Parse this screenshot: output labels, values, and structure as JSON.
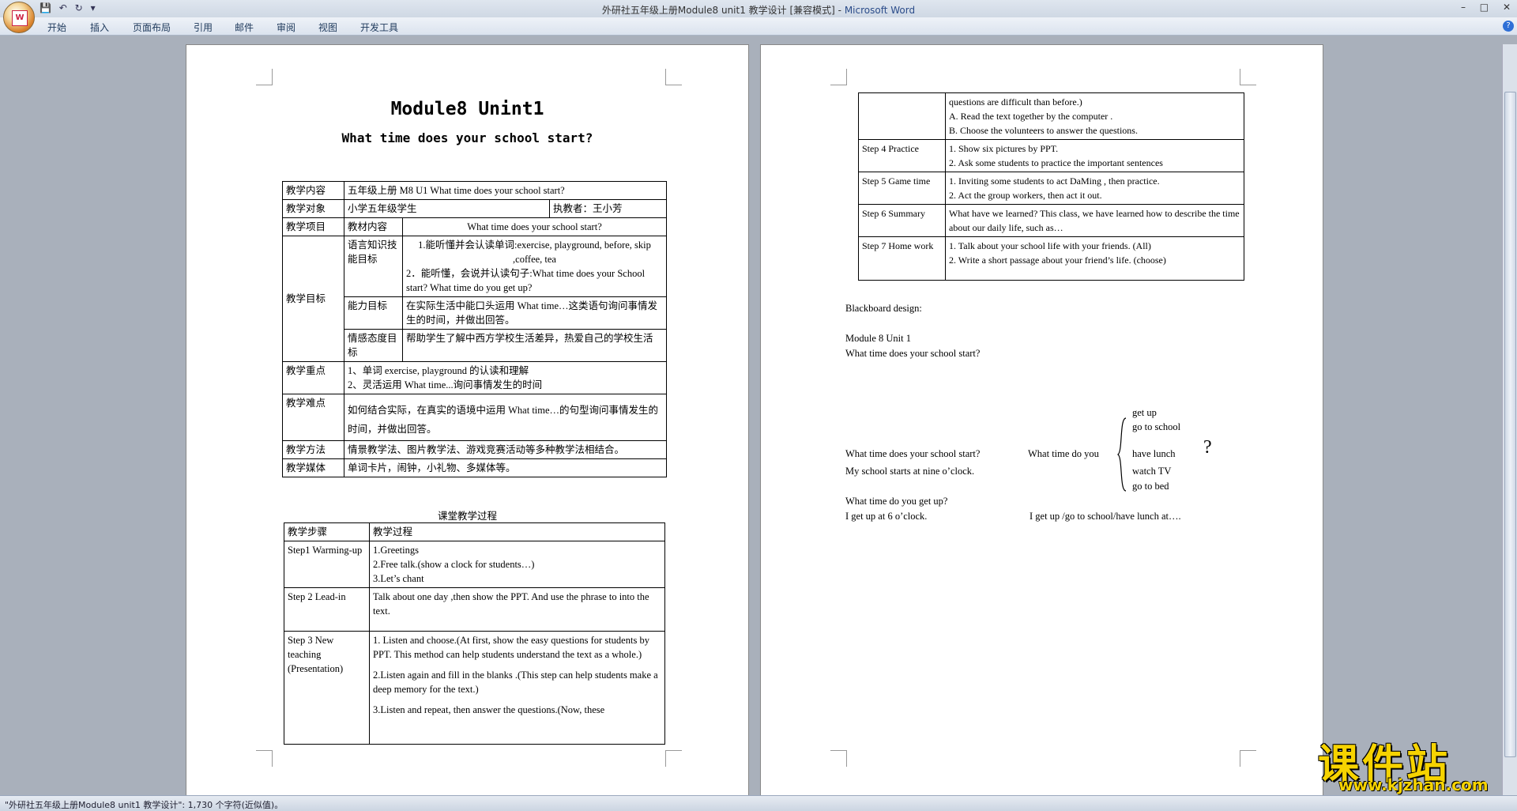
{
  "window": {
    "title": "外研社五年级上册Module8 unit1 教学设计 [兼容模式] - ",
    "app_name": "Microsoft Word",
    "office_logo": "W"
  },
  "menu": [
    "开始",
    "插入",
    "页面布局",
    "引用",
    "邮件",
    "审阅",
    "视图",
    "开发工具"
  ],
  "page1": {
    "title": "Module8 Unint1",
    "subtitle": "What time does your school start?",
    "info": {
      "content_label": "教学内容",
      "content_value": "五年级上册 M8 U1 What time does your school start?",
      "target_label": "教学对象",
      "target_value": "小学五年级学生",
      "teacher": "执教者：王小芳",
      "project_label": "教学项目",
      "material_label": "教材内容",
      "material_value": "What time does your school start?",
      "goal_label": "教学目标",
      "lang_label": "语言知识技能目标",
      "lang_1": "1.能听懂并会认读单词:exercise, playground, before, skip ,coffee, tea",
      "lang_2": "2．能听懂，会说并认读句子:What time does your School start? What time do you get up?",
      "ability_label": "能力目标",
      "ability_value": "在实际生活中能口头运用 What time…这类语句询问事情发生的时间，并做出回答。",
      "emotion_label": "情感态度目标",
      "emotion_value": "帮助学生了解中西方学校生活差异，热爱自己的学校生活",
      "key_label": "教学重点",
      "key_1": "1、单词 exercise, playground 的认读和理解",
      "key_2": "2、灵活运用 What time...询问事情发生的时间",
      "difficult_label": "教学难点",
      "difficult_value": "如何结合实际，在真实的语境中运用 What time…的句型询问事情发生的时间，并做出回答。",
      "method_label": "教学方法",
      "method_value": "情景教学法、图片教学法、游戏竞赛活动等多种教学法相结合。",
      "media_label": "教学媒体",
      "media_value": "单词卡片，闹钟，小礼物、多媒体等。"
    },
    "process_title": "课堂教学过程",
    "process_head": [
      "教学步骤",
      "教学过程"
    ],
    "steps": [
      {
        "step": "Step1 Warming-up",
        "lines": [
          "1.Greetings",
          "2.Free talk.(show a clock for students…)",
          "3.Let’s chant"
        ]
      },
      {
        "step": "Step 2 Lead-in",
        "lines": [
          "Talk about one day ,then show the PPT. And use the phrase to into the text."
        ]
      },
      {
        "step": "Step 3 New teaching (Presentation)",
        "lines": [
          "1. Listen and choose.(At first, show the easy questions for students by PPT. This method can help students understand the text as a whole.)",
          "2.Listen again and fill in the blanks .(This step can help students make a deep memory for the text.)",
          "3.Listen and repeat, then answer the questions.(Now, these"
        ]
      }
    ]
  },
  "page2": {
    "cont_lines": [
      "questions are difficult than before.)",
      "A. Read the text together by the computer .",
      "B. Choose the volunteers to answer the questions."
    ],
    "steps": [
      {
        "step": "Step 4 Practice",
        "lines": [
          "1. Show six pictures by PPT.",
          "2. Ask some students to practice the important sentences"
        ]
      },
      {
        "step": "Step 5 Game time",
        "lines": [
          "1. Inviting some students to act DaMing , then practice.",
          "2. Act the group workers, then act it out."
        ]
      },
      {
        "step": "Step 6 Summary",
        "lines": [
          "What have we learned? This class, we have learned how to describe the time about our daily life, such as…"
        ]
      },
      {
        "step": "Step 7 Home work",
        "lines": [
          "1. Talk about your school life with your friends. (All)",
          "2. Write a short passage about your friend’s life. (choose)"
        ]
      }
    ],
    "blackboard": {
      "heading": "Blackboard design:",
      "unit": "Module 8 Unit 1",
      "question": "What time does your school start?",
      "q1": "What time does your school start?",
      "a1": "My school starts at nine o’clock.",
      "prompt": "What time do you",
      "options": [
        "get up",
        "go to school",
        "have lunch",
        "watch TV",
        "go to bed"
      ],
      "qmark": "?",
      "q2": "What time do you get up?",
      "a2": "I get up at 6 o’clock.",
      "a3": "I get up /go to school/have lunch at…."
    }
  },
  "status": "\"外研社五年级上册Module8 unit1 教学设计\": 1,730 个字符(近似值)。",
  "watermark": {
    "cn": "课件站",
    "url": "www.kjzhan.com"
  }
}
